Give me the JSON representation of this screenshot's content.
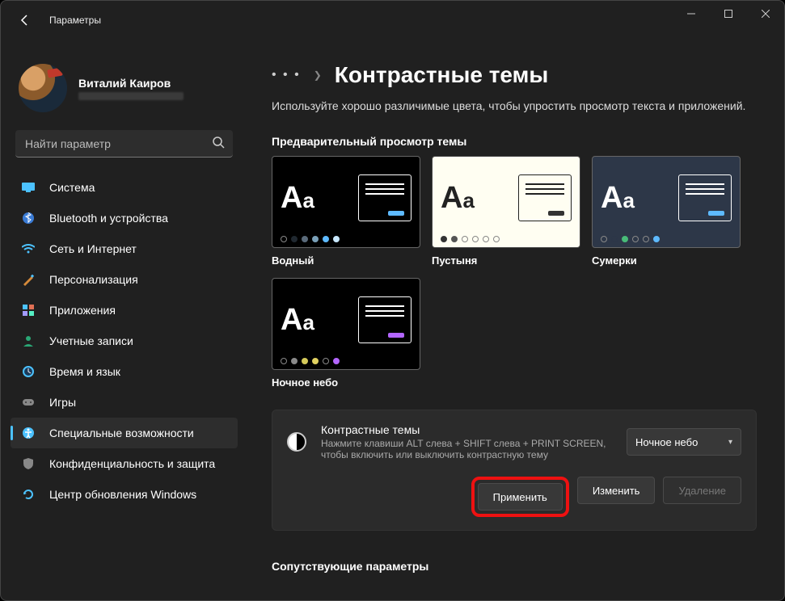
{
  "titlebar": {
    "title": "Параметры"
  },
  "profile": {
    "name": "Виталий Каиров"
  },
  "search": {
    "placeholder": "Найти параметр"
  },
  "nav": [
    {
      "label": "Система"
    },
    {
      "label": "Bluetooth и устройства"
    },
    {
      "label": "Сеть и Интернет"
    },
    {
      "label": "Персонализация"
    },
    {
      "label": "Приложения"
    },
    {
      "label": "Учетные записи"
    },
    {
      "label": "Время и язык"
    },
    {
      "label": "Игры"
    },
    {
      "label": "Специальные возможности"
    },
    {
      "label": "Конфиденциальность и защита"
    },
    {
      "label": "Центр обновления Windows"
    }
  ],
  "breadcrumb": {
    "title": "Контрастные темы"
  },
  "description": "Используйте хорошо различимые цвета, чтобы упростить просмотр текста и приложений.",
  "preview_label": "Предварительный просмотр темы",
  "themes": {
    "aquatic": "Водный",
    "desert": "Пустыня",
    "dusk": "Сумерки",
    "night": "Ночное небо"
  },
  "card": {
    "title": "Контрастные темы",
    "desc": "Нажмите клавиши ALT слева + SHIFT слева + PRINT SCREEN, чтобы включить или выключить контрастную тему",
    "dropdown": "Ночное небо",
    "apply": "Применить",
    "edit": "Изменить",
    "delete": "Удаление"
  },
  "related": "Сопутствующие параметры"
}
